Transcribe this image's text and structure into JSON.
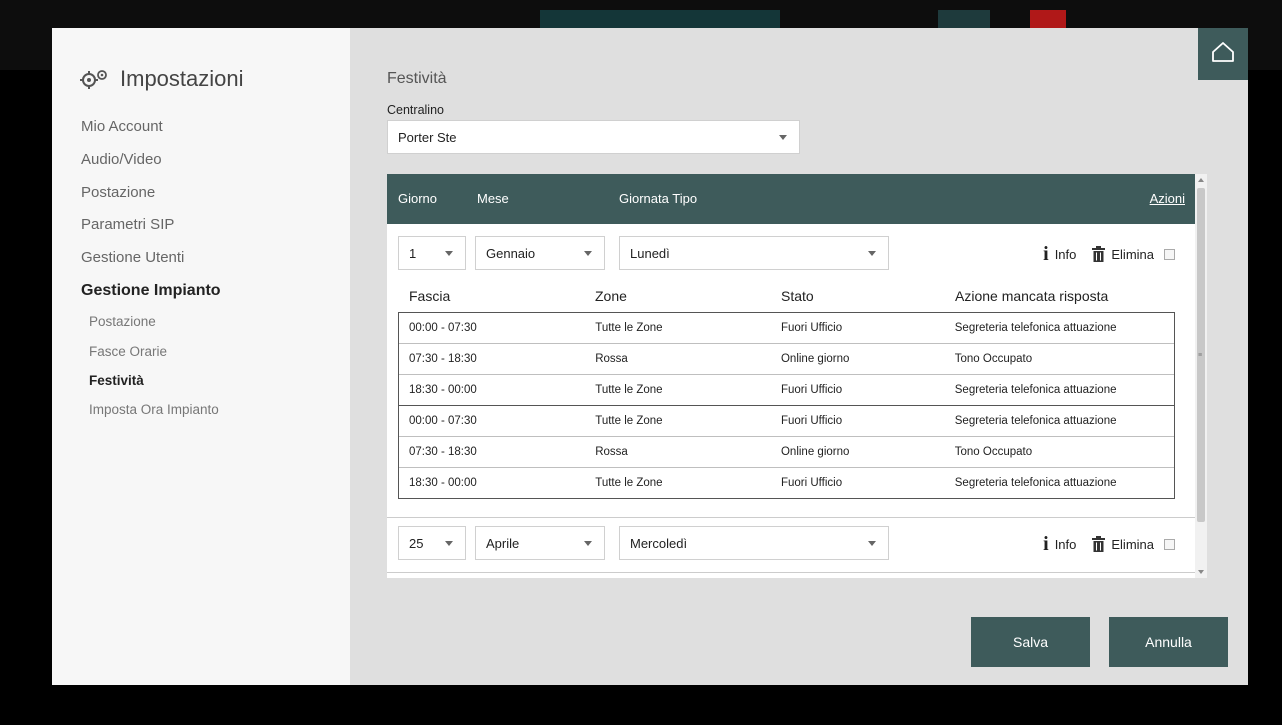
{
  "sidebar": {
    "title": "Impostazioni",
    "items": [
      {
        "label": "Mio Account"
      },
      {
        "label": "Audio/Video"
      },
      {
        "label": "Postazione"
      },
      {
        "label": "Parametri SIP"
      },
      {
        "label": "Gestione Utenti"
      },
      {
        "label": "Gestione Impianto"
      }
    ],
    "subitems": [
      {
        "label": "Postazione"
      },
      {
        "label": "Fasce Orarie"
      },
      {
        "label": "Festività"
      },
      {
        "label": "Imposta Ora Impianto"
      }
    ]
  },
  "main": {
    "title": "Festività",
    "centralino_label": "Centralino",
    "centralino_value": "Porter Ste",
    "table_header": {
      "giorno": "Giorno",
      "mese": "Mese",
      "giornata_tipo": "Giornata Tipo",
      "azioni": "Azioni"
    },
    "entries": [
      {
        "giorno": "1",
        "mese": "Gennaio",
        "giornata": "Lunedì",
        "info": "Info",
        "elimina": "Elimina"
      },
      {
        "giorno": "25",
        "mese": "Aprile",
        "giornata": "Mercoledì",
        "info": "Info",
        "elimina": "Elimina"
      }
    ],
    "schedule_columns": {
      "fascia": "Fascia",
      "zone": "Zone",
      "stato": "Stato",
      "azione": "Azione mancata risposta"
    },
    "schedule_rows": [
      {
        "fascia": "00:00 - 07:30",
        "zone": "Tutte le Zone",
        "stato": "Fuori Ufficio",
        "azione": "Segreteria telefonica attuazione"
      },
      {
        "fascia": "07:30 - 18:30",
        "zone": "Rossa",
        "stato": "Online giorno",
        "azione": "Tono Occupato"
      },
      {
        "fascia": "18:30 - 00:00",
        "zone": "Tutte le Zone",
        "stato": "Fuori Ufficio",
        "azione": "Segreteria telefonica attuazione"
      },
      {
        "fascia": "00:00 - 07:30",
        "zone": "Tutte le Zone",
        "stato": "Fuori Ufficio",
        "azione": "Segreteria telefonica attuazione"
      },
      {
        "fascia": "07:30 - 18:30",
        "zone": "Rossa",
        "stato": "Online giorno",
        "azione": "Tono Occupato"
      },
      {
        "fascia": "18:30 - 00:00",
        "zone": "Tutte le Zone",
        "stato": "Fuori Ufficio",
        "azione": "Segreteria telefonica attuazione"
      }
    ]
  },
  "buttons": {
    "salva": "Salva",
    "annulla": "Annulla"
  },
  "colors": {
    "accent": "#3e5b5b",
    "sidebar_bg": "#f7f7f7",
    "main_bg": "#dfdfdf"
  },
  "icons": [
    "gears-icon",
    "home-icon",
    "info-icon",
    "trash-icon",
    "chevron-down-icon"
  ]
}
